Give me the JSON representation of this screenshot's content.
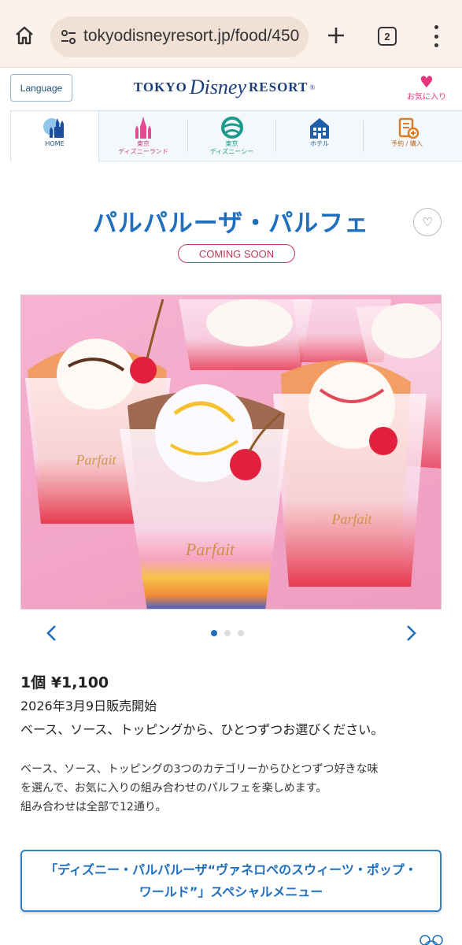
{
  "browser": {
    "url": "tokyodisneyresort.jp/food/450",
    "tab_count": "2",
    "icons": {
      "home": "home-icon",
      "site_info": "tune-icon",
      "new_tab": "plus-icon",
      "menu": "kebab-menu-icon"
    }
  },
  "header": {
    "language_label": "Language",
    "logo": {
      "part1": "TOKYO",
      "part2": "Disney",
      "part3": "RESORT",
      "reg": "®"
    },
    "favorites_label": "お気に入り"
  },
  "nav": {
    "items": [
      {
        "label": "HOME",
        "icon": "castle-globe-icon",
        "active": true
      },
      {
        "label": "東京\nディズニーランド",
        "icon": "castle-icon",
        "active": false
      },
      {
        "label": "東京\nディズニーシー",
        "icon": "aquasphere-icon",
        "active": false
      },
      {
        "label": "ホテル",
        "icon": "hotel-icon",
        "active": false
      },
      {
        "label": "予約 / 購入",
        "icon": "reservation-icon",
        "active": false
      }
    ]
  },
  "product": {
    "title": "パルパルーザ・パルフェ",
    "badge": "COMING SOON",
    "price": "1個 ¥1,100",
    "sale_date": "2026年3月9日販売開始",
    "choose_text": "ベース、ソース、トッピングから、ひとつずつお選びください。",
    "description_lines": [
      "ベース、ソース、トッピングの3つのカテゴリーからひとつずつ好きな味",
      "を選んで、お気に入りの組み合わせのパルフェを楽しめます。",
      "組み合わせは全部で12通り。"
    ],
    "image_alt": "parfait-photo",
    "carousel": {
      "total": 3,
      "current": 1
    }
  },
  "special_menu_link": "「ディズニー・パルパルーザ“ヴァネロペのスウィーツ・ポップ・ワールド”」スペシャルメニュー",
  "colors": {
    "accent": "#1f6fbf",
    "pink": "#e8347d",
    "badge": "#c4375b"
  }
}
